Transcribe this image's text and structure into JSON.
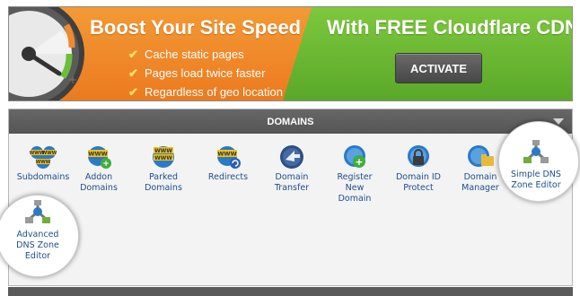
{
  "banner": {
    "title_left": "Boost Your Site Speed",
    "title_right": "With FREE Cloudflare CDN",
    "bullets": [
      "Cache static pages",
      "Pages load twice faster",
      "Regardless of geo location"
    ],
    "activate_label": "ACTIVATE",
    "colors": {
      "orange": "#ec7a1f",
      "green": "#5aa829",
      "button": "#474747"
    }
  },
  "domains": {
    "header": "DOMAINS",
    "items": [
      {
        "label": "Subdomains",
        "icon": "subdomains-icon"
      },
      {
        "label": "Addon\nDomains",
        "icon": "addon-domains-icon"
      },
      {
        "label": "Parked\nDomains",
        "icon": "parked-domains-icon"
      },
      {
        "label": "Redirects",
        "icon": "redirects-icon"
      },
      {
        "label": "Domain\nTransfer",
        "icon": "domain-transfer-icon"
      },
      {
        "label": "Register\nNew\nDomain",
        "icon": "register-domain-icon"
      },
      {
        "label": "Domain ID\nProtect",
        "icon": "domain-id-protect-icon"
      },
      {
        "label": "Domain\nManager",
        "icon": "domain-manager-icon"
      },
      {
        "label": "Simple DNS\nZone Editor",
        "icon": "simple-dns-zone-editor-icon"
      },
      {
        "label": "Advanced\nDNS Zone\nEditor",
        "icon": "advanced-dns-zone-editor-icon"
      }
    ]
  }
}
